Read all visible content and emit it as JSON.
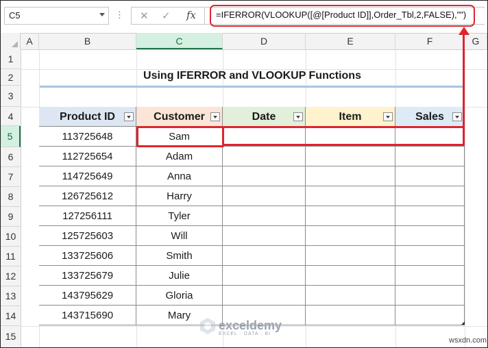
{
  "formula_bar": {
    "name_box": "C5",
    "cancel_glyph": "✕",
    "enter_glyph": "✓",
    "fx_label": "fx",
    "formula": "=IFERROR(VLOOKUP([@[Product ID]],Order_Tbl,2,FALSE),\"\")"
  },
  "columns": [
    "A",
    "B",
    "C",
    "D",
    "E",
    "F",
    "G"
  ],
  "rows": [
    "1",
    "2",
    "3",
    "4",
    "5",
    "6",
    "7",
    "8",
    "9",
    "10",
    "11",
    "12",
    "13",
    "14",
    "15"
  ],
  "selected": {
    "column": "C",
    "row": "5"
  },
  "sheet_title": "Using IFERROR and VLOOKUP Functions",
  "table": {
    "headers": [
      "Product ID",
      "Customer",
      "Date",
      "Item",
      "Sales"
    ],
    "rows": [
      {
        "product_id": "113725648",
        "customer": "Sam"
      },
      {
        "product_id": "112725654",
        "customer": "Adam"
      },
      {
        "product_id": "114725649",
        "customer": "Anna"
      },
      {
        "product_id": "126725612",
        "customer": "Harry"
      },
      {
        "product_id": "127256111",
        "customer": "Tyler"
      },
      {
        "product_id": "125725603",
        "customer": "Will"
      },
      {
        "product_id": "133725606",
        "customer": "Smith"
      },
      {
        "product_id": "133725679",
        "customer": "Julie"
      },
      {
        "product_id": "143795629",
        "customer": "Gloria"
      },
      {
        "product_id": "143715690",
        "customer": "Mary"
      }
    ]
  },
  "colors": {
    "highlight_red": "#e0242e",
    "header_product": "#dde7f4",
    "header_customer": "#fbe5d6",
    "header_date": "#e2efda",
    "header_item": "#fff2cc",
    "header_sales": "#ddebf7"
  },
  "watermark": {
    "name": "exceldemy",
    "tagline": "EXCEL · DATA · BI"
  },
  "credit": "wsxdn.com"
}
